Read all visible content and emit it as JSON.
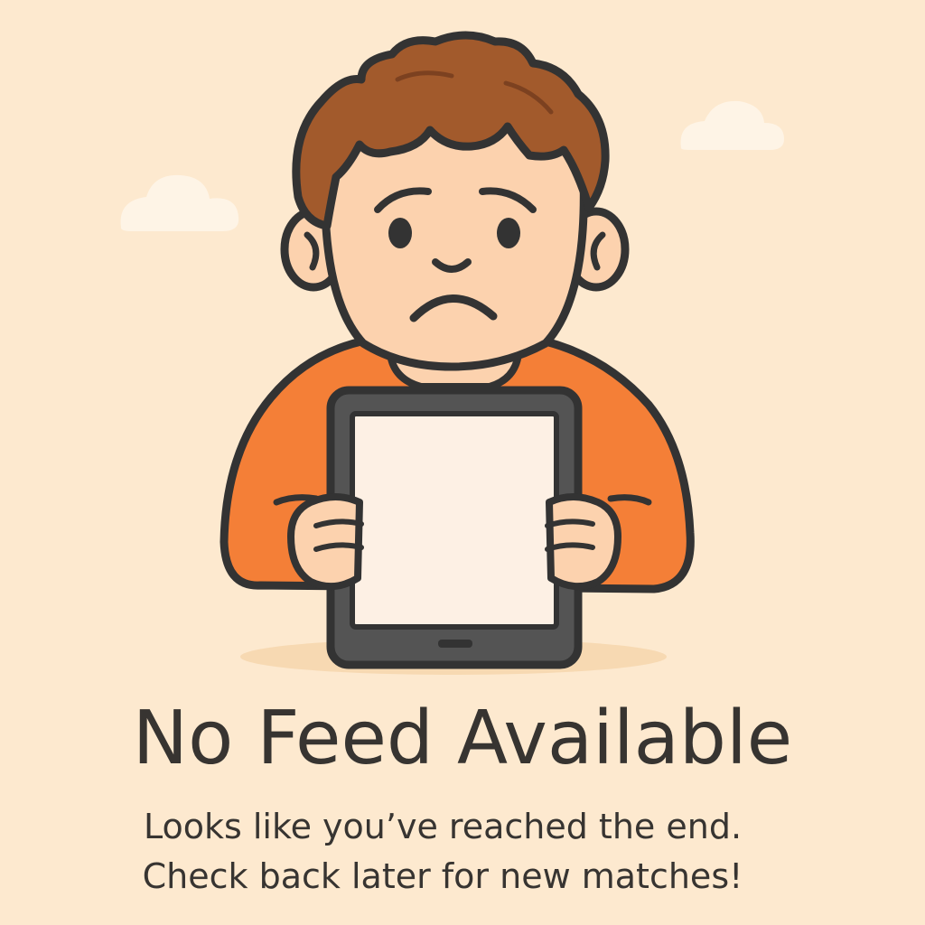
{
  "empty_state": {
    "title": "No Feed Available",
    "message_line_1": "Looks like you’ve reached the end.",
    "message_line_2": "Check back later for new matches!"
  },
  "illustration": {
    "subject": "sad-boy-holding-blank-tablet",
    "icons": [
      "cloud-icon",
      "sad-boy-illustration",
      "blank-tablet-icon",
      "home-button-icon"
    ]
  },
  "colors": {
    "background": "#fde9cf",
    "text": "#373431",
    "shirt": "#f47f37",
    "hair": "#a25a2c",
    "skin": "#fcd2ae",
    "tablet_frame": "#545454",
    "tablet_screen": "#fdf0e4",
    "cloud": "#fef4e6",
    "outline": "#333333"
  }
}
